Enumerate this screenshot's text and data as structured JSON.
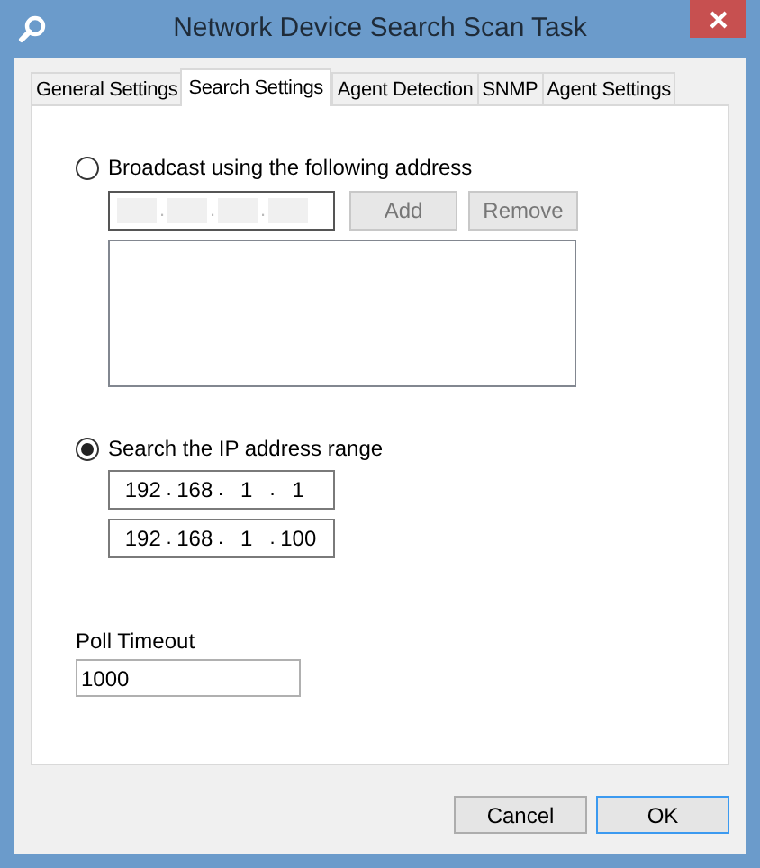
{
  "window": {
    "title": "Network Device Search Scan Task"
  },
  "tabs": [
    {
      "label": "General Settings",
      "selected": false
    },
    {
      "label": "Search Settings",
      "selected": true
    },
    {
      "label": "Agent Detection",
      "selected": false
    },
    {
      "label": "SNMP",
      "selected": false
    },
    {
      "label": "Agent Settings",
      "selected": false
    }
  ],
  "broadcast": {
    "label": "Broadcast using the following address",
    "selected": false,
    "address": {
      "separator": ".",
      "disabled": true
    },
    "buttons": [
      "Add",
      "Remove"
    ]
  },
  "range": {
    "label": "Search the IP address range",
    "selected": true,
    "start": {
      "separator": ".",
      "octets": [
        "192",
        "168",
        "1",
        "1"
      ]
    },
    "end": {
      "separator": ".",
      "octets": [
        "192",
        "168",
        "1",
        "100"
      ]
    }
  },
  "poll_timeout": {
    "label": "Poll Timeout",
    "value": "1000"
  },
  "buttons": [
    {
      "label": "Cancel",
      "default": false
    },
    {
      "label": "OK",
      "default": true
    }
  ]
}
